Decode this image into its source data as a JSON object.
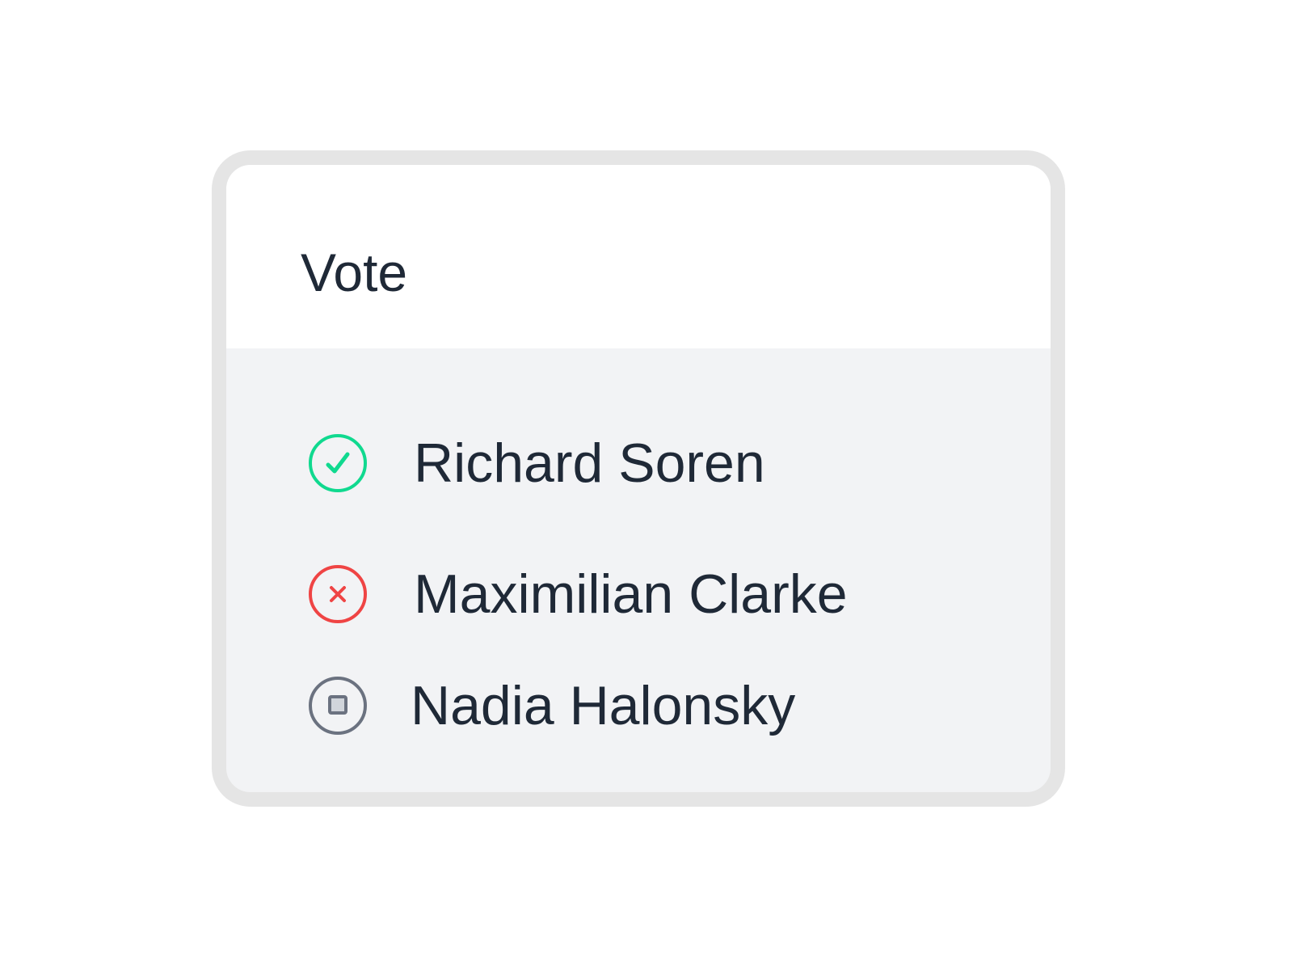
{
  "card": {
    "title": "Vote"
  },
  "voters": [
    {
      "name": "Richard Soren",
      "status": "approved",
      "icon": "check-circle-icon",
      "color": "#10d98f"
    },
    {
      "name": "Maximilian Clarke",
      "status": "rejected",
      "icon": "x-circle-icon",
      "color": "#ef4444"
    },
    {
      "name": "Nadia Halonsky",
      "status": "abstained",
      "icon": "stop-circle-icon",
      "color": "#6b7280"
    }
  ],
  "colors": {
    "text": "#1f2937",
    "border": "#e5e5e5",
    "body_background": "#f2f3f5",
    "header_background": "#ffffff"
  }
}
